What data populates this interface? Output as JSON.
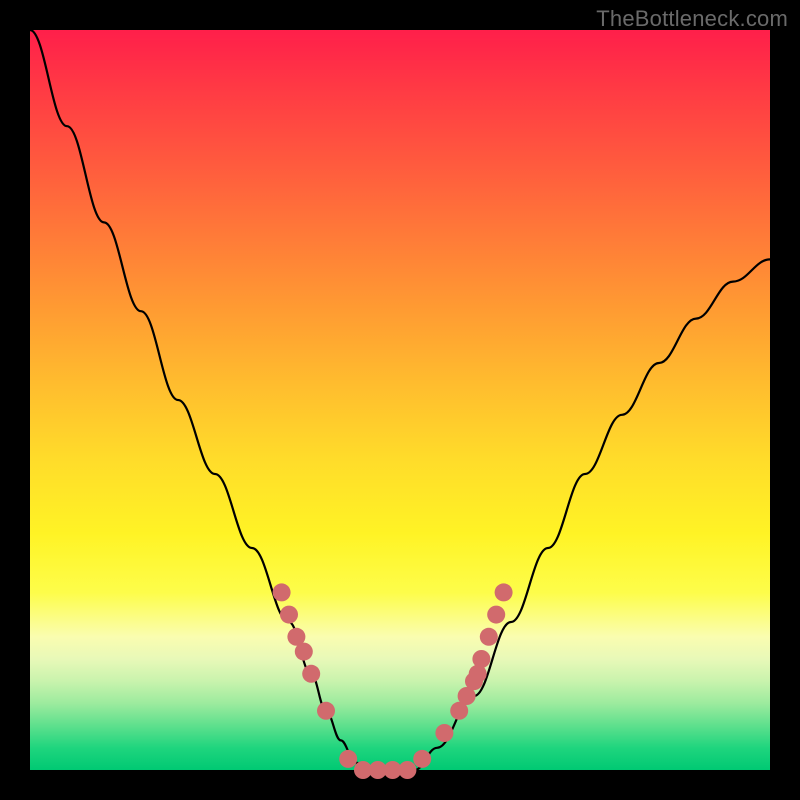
{
  "watermark": "TheBottleneck.com",
  "frame": {
    "bg_top": "#ff1f4a",
    "bg_bottom": "#00c973",
    "border": "#000000"
  },
  "chart_data": {
    "type": "line",
    "title": "",
    "xlabel": "",
    "ylabel": "",
    "xlim": [
      0,
      100
    ],
    "ylim": [
      0,
      100
    ],
    "grid": false,
    "legend": false,
    "series": [
      {
        "name": "bottleneck-curve",
        "color": "#000000",
        "x": [
          0,
          5,
          10,
          15,
          20,
          25,
          30,
          35,
          38,
          40,
          42,
          44,
          46,
          48,
          50,
          52,
          55,
          60,
          65,
          70,
          75,
          80,
          85,
          90,
          95,
          100
        ],
        "y": [
          100,
          87,
          74,
          62,
          50,
          40,
          30,
          20,
          13,
          8,
          4,
          1,
          0,
          0,
          0,
          0,
          3,
          10,
          20,
          30,
          40,
          48,
          55,
          61,
          66,
          69
        ]
      }
    ],
    "markers": {
      "name": "highlighted-points",
      "color": "#d16a6d",
      "points": [
        {
          "x": 34,
          "y": 24
        },
        {
          "x": 35,
          "y": 21
        },
        {
          "x": 36,
          "y": 18
        },
        {
          "x": 37,
          "y": 16
        },
        {
          "x": 38,
          "y": 13
        },
        {
          "x": 40,
          "y": 8
        },
        {
          "x": 43,
          "y": 1.5
        },
        {
          "x": 45,
          "y": 0
        },
        {
          "x": 47,
          "y": 0
        },
        {
          "x": 49,
          "y": 0
        },
        {
          "x": 51,
          "y": 0
        },
        {
          "x": 53,
          "y": 1.5
        },
        {
          "x": 56,
          "y": 5
        },
        {
          "x": 58,
          "y": 8
        },
        {
          "x": 59,
          "y": 10
        },
        {
          "x": 60,
          "y": 12
        },
        {
          "x": 60.5,
          "y": 13
        },
        {
          "x": 61,
          "y": 15
        },
        {
          "x": 62,
          "y": 18
        },
        {
          "x": 63,
          "y": 21
        },
        {
          "x": 64,
          "y": 24
        }
      ]
    }
  }
}
